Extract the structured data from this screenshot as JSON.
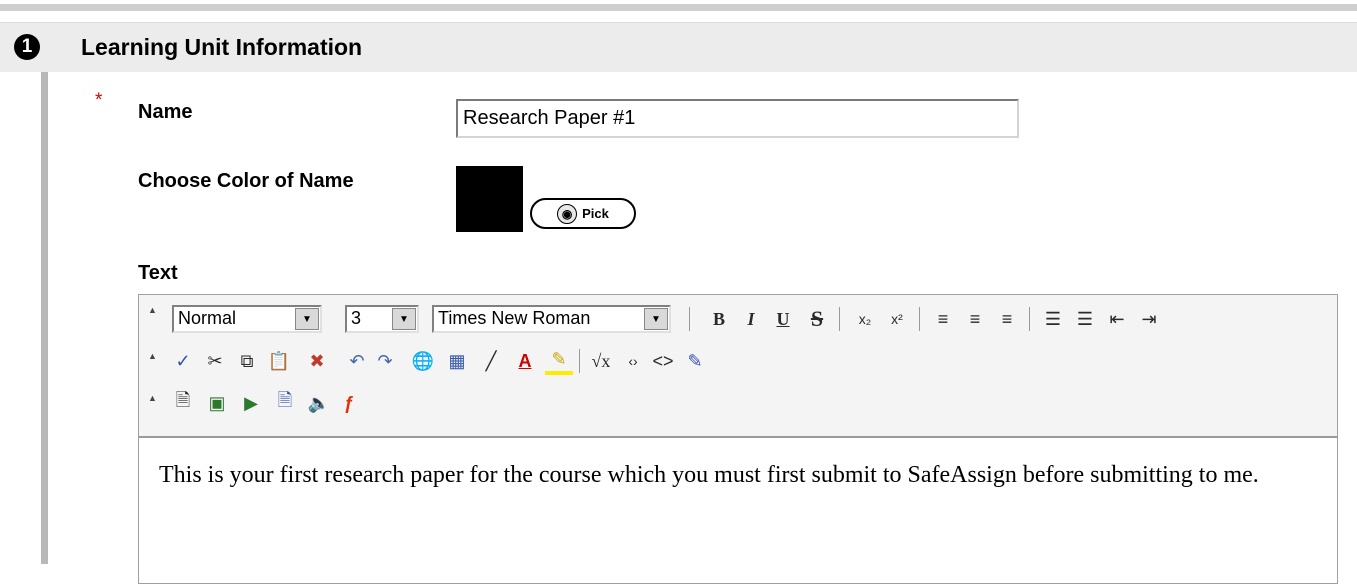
{
  "section": {
    "step_number": "1",
    "title": "Learning Unit Information"
  },
  "form": {
    "required_marker": "*",
    "name_label": "Name",
    "name_value": "Research Paper #1",
    "color_label": "Choose Color of Name",
    "color_value": "#000000",
    "pick_label": "Pick",
    "text_label": "Text"
  },
  "editor": {
    "format_select": "Normal",
    "size_select": "3",
    "font_select": "Times New Roman",
    "row1_icons": [
      "bold-icon",
      "italic-icon",
      "underline-icon",
      "strikethrough-icon",
      "subscript-icon",
      "superscript-icon",
      "align-left-icon",
      "align-center-icon",
      "align-right-icon",
      "numbered-list-icon",
      "bulleted-list-icon",
      "outdent-icon",
      "indent-icon"
    ],
    "row2_icons": [
      "spellcheck-icon",
      "cut-icon",
      "copy-icon",
      "paste-icon",
      "remove-format-icon",
      "undo-icon",
      "redo-icon",
      "insert-link-icon",
      "insert-table-icon",
      "horizontal-rule-icon",
      "text-color-icon",
      "highlight-color-icon",
      "equation-icon",
      "html-view-icon",
      "source-code-icon",
      "preview-icon"
    ],
    "row3_icons": [
      "attach-file-icon",
      "insert-image-icon",
      "insert-media-icon",
      "insert-document-icon",
      "insert-audio-icon",
      "insert-flash-icon"
    ],
    "content": "This is your first research paper for the course which you must first submit to SafeAssign before submitting to me."
  }
}
